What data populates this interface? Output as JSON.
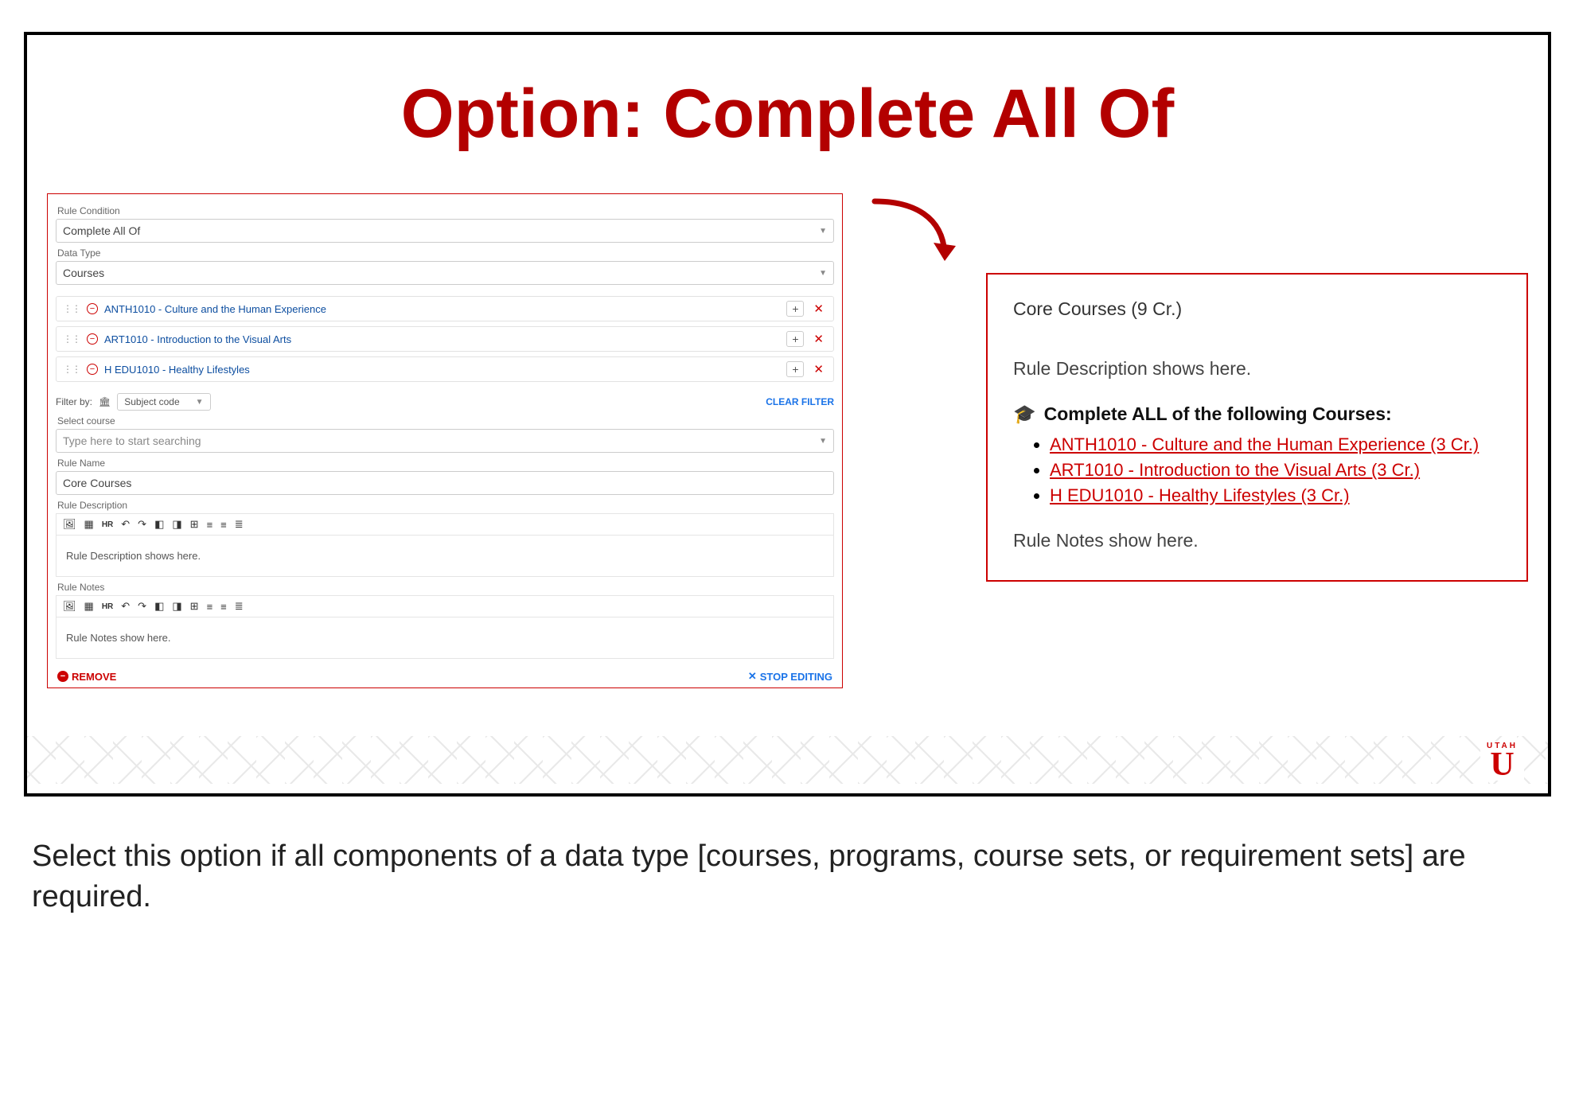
{
  "slide": {
    "title": "Option: Complete All Of"
  },
  "form": {
    "rule_condition_label": "Rule Condition",
    "rule_condition_value": "Complete All Of",
    "data_type_label": "Data Type",
    "data_type_value": "Courses",
    "courses": [
      {
        "name": "ANTH1010 - Culture and the Human Experience"
      },
      {
        "name": "ART1010 - Introduction to the Visual Arts"
      },
      {
        "name": "H EDU1010 - Healthy Lifestyles"
      }
    ],
    "filter_by_label": "Filter by:",
    "filter_value": "Subject code",
    "clear_filter": "CLEAR FILTER",
    "select_course_label": "Select course",
    "select_course_placeholder": "Type here to start searching",
    "rule_name_label": "Rule Name",
    "rule_name_value": "Core Courses",
    "rule_description_label": "Rule Description",
    "rule_description_text": "Rule Description shows here.",
    "rule_notes_label": "Rule Notes",
    "rule_notes_text": "Rule Notes show here.",
    "hr_label": "HR",
    "remove_label": "REMOVE",
    "stop_editing_label": "STOP EDITING"
  },
  "preview": {
    "title": "Core Courses (9 Cr.)",
    "desc_line": "Rule Description shows here.",
    "heading": "Complete ALL of the following Courses:",
    "items": [
      "ANTH1010 - Culture and the Human Experience (3 Cr.)",
      "ART1010 - Introduction to the Visual Arts (3 Cr.)",
      "H EDU1010 - Healthy Lifestyles (3 Cr.)"
    ],
    "notes_line": "Rule Notes show here."
  },
  "logo": {
    "top": "UTAH",
    "letter": "U"
  },
  "caption": "Select this option if all components of a data type [courses, programs, course sets, or requirement sets] are required."
}
